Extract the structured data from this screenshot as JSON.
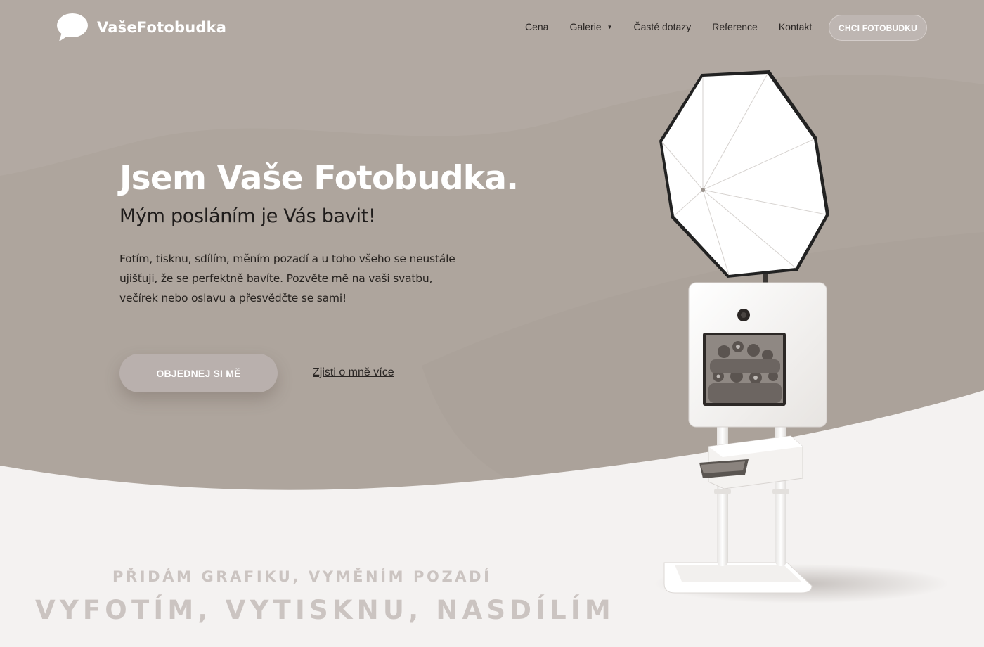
{
  "brand": {
    "name": "VašeFotobudka"
  },
  "nav": {
    "items": [
      {
        "label": "Cena",
        "has_dropdown": false
      },
      {
        "label": "Galerie",
        "has_dropdown": true
      },
      {
        "label": "Časté dotazy",
        "has_dropdown": false
      },
      {
        "label": "Reference",
        "has_dropdown": false
      },
      {
        "label": "Kontakt",
        "has_dropdown": false
      }
    ],
    "cta_label": "CHCI FOTOBUDKU",
    "dropdown_icon": "triangle-down"
  },
  "hero": {
    "title": "Jsem Vaše Fotobudka.",
    "subtitle": "Mým posláním je Vás bavit!",
    "description": "Fotím, tisknu, sdílím, měním pozadí a u toho všeho se neustále ujišťuji, že se perfektně bavíte. Pozvěte mě na vaši svatbu, večírek nebo oslavu a přesvědčte se sami!",
    "primary_button": "OBJEDNEJ SI MĚ",
    "secondary_link": "Zjisti o mně více",
    "image": "photobooth-with-umbrella"
  },
  "taglines": {
    "line1": "PŘIDÁM GRAFIKU, VYMĚNÍM POZADÍ",
    "line2": "VYFOTÍM, VYTISKNU, NASDÍLÍM"
  },
  "colors": {
    "hero_background": "#aea59d",
    "page_background": "#f4f2f1",
    "button": "#b9b0ad",
    "tagline": "#cbc4c1",
    "title": "#ffffff"
  }
}
